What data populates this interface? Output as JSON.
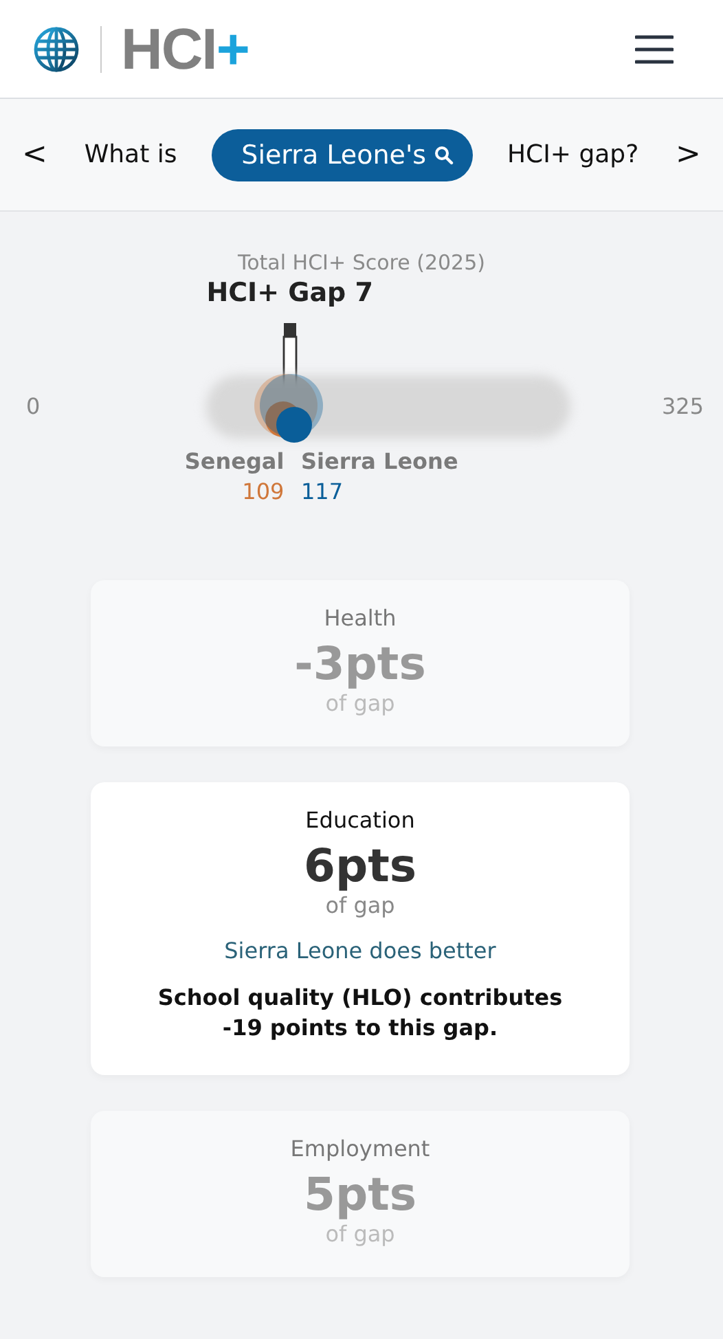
{
  "header": {
    "logo_text": "HCI",
    "logo_plus": "+"
  },
  "question": {
    "prev": "<",
    "before": "What is",
    "country": "Sierra Leone's",
    "after": "HCI+ gap?",
    "next": ">"
  },
  "chart": {
    "title": "Total HCI+ Score (2025)",
    "gap_label": "HCI+ Gap 7",
    "scale_min": "0",
    "scale_max": "325",
    "countries": [
      {
        "name": "Senegal",
        "score": "109",
        "color": "#d0773a"
      },
      {
        "name": "Sierra Leone",
        "score": "117",
        "color": "#0a5e99"
      }
    ]
  },
  "cards": [
    {
      "title": "Health",
      "value": "-3pts",
      "unit": "of gap",
      "selected": false
    },
    {
      "title": "Education",
      "value": "6pts",
      "unit": "of gap",
      "selected": true,
      "verdict": "Sierra Leone does better",
      "detail": "School quality (HLO) contributes -19 points to this gap."
    },
    {
      "title": "Employment",
      "value": "5pts",
      "unit": "of gap",
      "selected": false
    }
  ]
}
